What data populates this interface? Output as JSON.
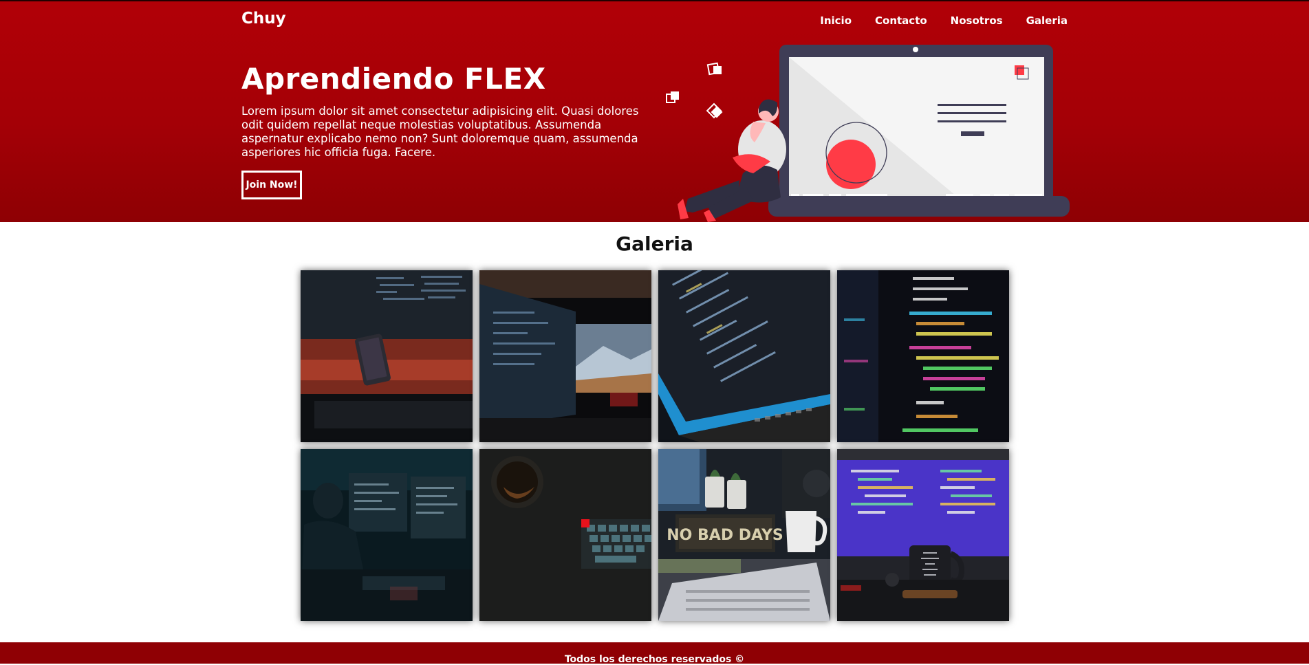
{
  "header": {
    "logo": "Chuy",
    "nav": [
      "Inicio",
      "Contacto",
      "Nosotros",
      "Galeria"
    ]
  },
  "hero": {
    "title": "Aprendiendo FLEX",
    "text": "Lorem ipsum dolor sit amet consectetur adipisicing elit. Quasi dolores odit quidem repellat neque molestias voluptatibus. Assumenda aspernatur explicabo nemo non? Sunt doloremque quam, assumenda asperiores hic officia fuga. Facere.",
    "button": "Join Now!"
  },
  "gallery": {
    "title": "Galeria",
    "images": [
      {
        "icon": "dark-desk-phone-code-image"
      },
      {
        "icon": "multi-monitor-desk-image"
      },
      {
        "icon": "laptop-code-closeup-image"
      },
      {
        "icon": "colorful-code-screen-image"
      },
      {
        "icon": "developer-at-monitors-image"
      },
      {
        "icon": "coffee-keyboard-image"
      },
      {
        "icon": "no-bad-days-desk-image"
      },
      {
        "icon": "purple-code-mug-image"
      }
    ]
  },
  "footer": {
    "text": "Todos los derechos reservados ©"
  },
  "colors": {
    "brand_red": "#a40006",
    "footer_red": "#8f0004",
    "accent_pink": "#ff3b46",
    "laptop_dark": "#3f3d56"
  }
}
